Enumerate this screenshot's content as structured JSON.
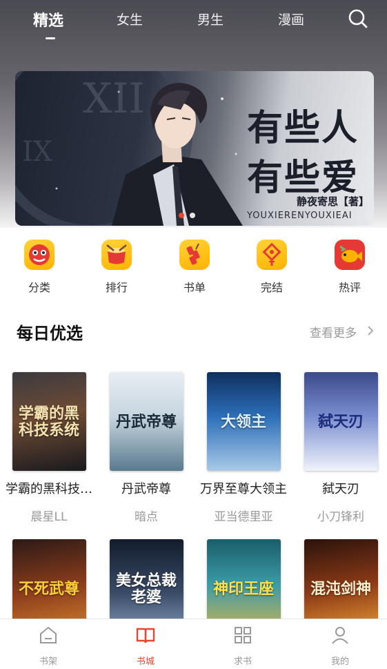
{
  "top_tabs": [
    {
      "label": "精选",
      "active": true
    },
    {
      "label": "女生",
      "active": false
    },
    {
      "label": "男生",
      "active": false
    },
    {
      "label": "漫画",
      "active": false
    }
  ],
  "search_icon": "search-icon",
  "banner": {
    "title_line1": "有些人",
    "title_line2": "有些爱",
    "author": "静夜寄思【著】",
    "pinyin": "YOUXIERENYOUXIEAI",
    "page_count": 2,
    "active_page": 1
  },
  "entries": [
    {
      "label": "分类",
      "icon": "lion-dance-icon"
    },
    {
      "label": "排行",
      "icon": "drum-icon"
    },
    {
      "label": "书单",
      "icon": "firecracker-icon"
    },
    {
      "label": "完结",
      "icon": "chinese-knot-icon"
    },
    {
      "label": "热评",
      "icon": "koi-fish-icon"
    }
  ],
  "daily": {
    "title": "每日优选",
    "more_label": "查看更多",
    "books": [
      {
        "title": "学霸的黑科技…",
        "author": "晨星LL",
        "cover_text": "学霸的黑科技系统"
      },
      {
        "title": "丹武帝尊",
        "author": "暗点",
        "cover_text": "丹武帝尊"
      },
      {
        "title": "万界至尊大领主",
        "author": "亚当德里亚",
        "cover_text": "大领主"
      },
      {
        "title": "弑天刃",
        "author": "小刀锋利",
        "cover_text": "弑天刃"
      }
    ],
    "books_row2": [
      {
        "cover_text": "不死武尊"
      },
      {
        "cover_text": "美女总裁老婆"
      },
      {
        "cover_text": "神印王座"
      },
      {
        "cover_text": "混沌剑神"
      }
    ]
  },
  "bottom_nav": [
    {
      "label": "书架",
      "icon": "bookshelf-icon",
      "active": false
    },
    {
      "label": "书城",
      "icon": "open-book-icon",
      "active": true
    },
    {
      "label": "求书",
      "icon": "grid-icon",
      "active": false
    },
    {
      "label": "我的",
      "icon": "user-icon",
      "active": false
    }
  ],
  "colors": {
    "accent": "#e8452e",
    "muted": "#999999",
    "entry_icon_bg": "#ffc21a"
  }
}
